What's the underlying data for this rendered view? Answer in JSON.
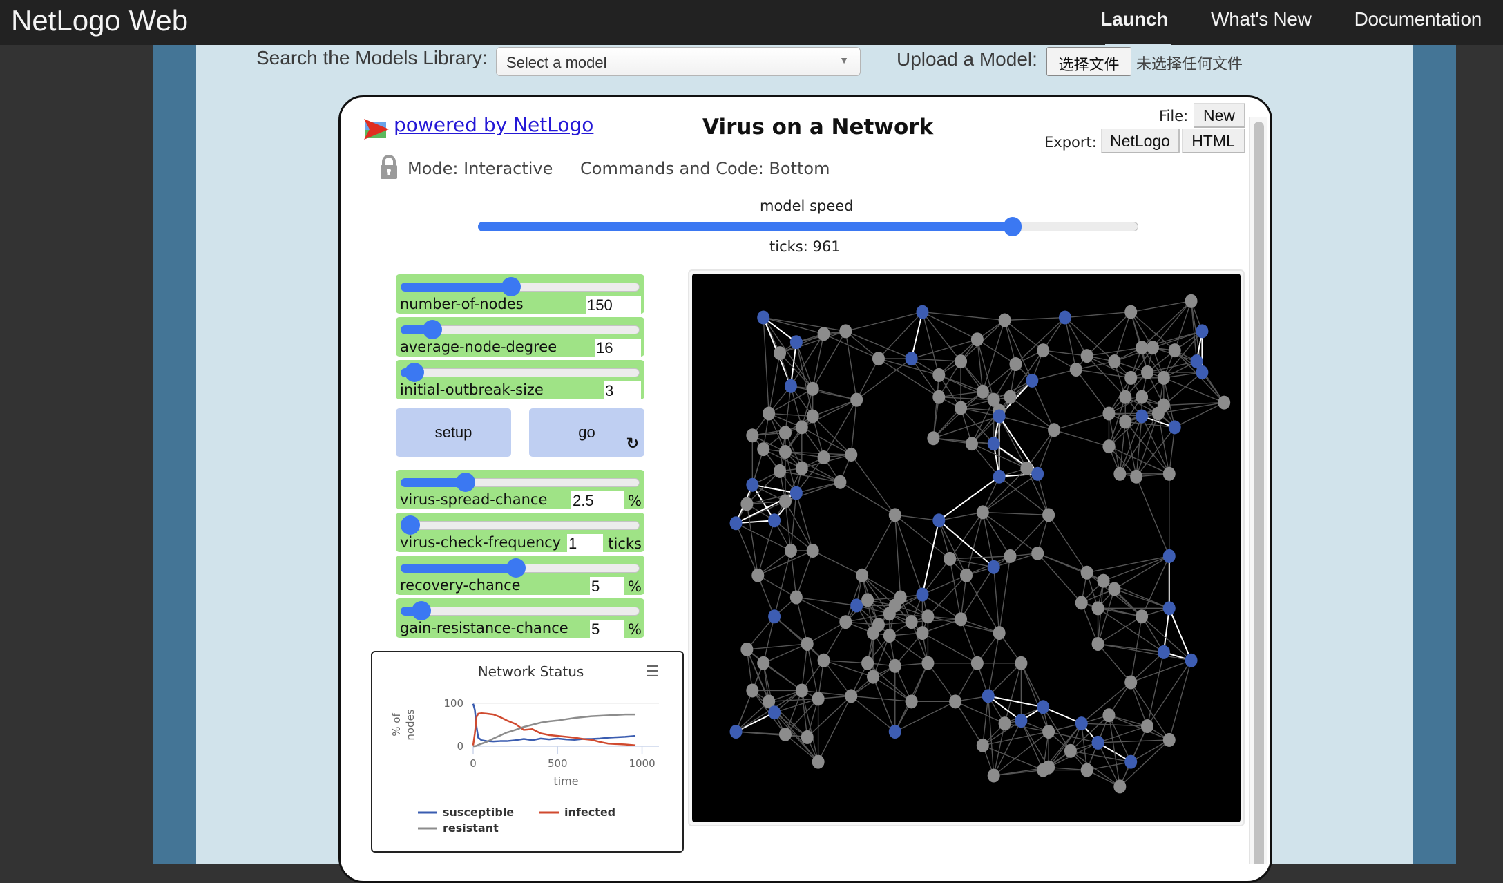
{
  "topbar": {
    "brand": "NetLogo Web",
    "nav": [
      {
        "label": "Launch",
        "active": true
      },
      {
        "label": "What's New",
        "active": false
      },
      {
        "label": "Documentation",
        "active": false
      }
    ]
  },
  "library": {
    "search_label": "Search the Models Library:",
    "select_value": "Select a model",
    "upload_label": "Upload a Model:",
    "upload_button": "选择文件",
    "upload_status": "未选择任何文件"
  },
  "model": {
    "powered_by": "powered by NetLogo",
    "title": "Virus on a Network",
    "mode": "Mode: Interactive",
    "commands_position": "Commands and Code: Bottom",
    "file_label": "File:",
    "file_new": "New",
    "export_label": "Export:",
    "export_netlogo": "NetLogo",
    "export_html": "HTML",
    "speed_label": "model speed",
    "speed_fraction": 0.81,
    "ticks_label": "ticks: 961"
  },
  "sliders": [
    {
      "name": "number-of-nodes",
      "value": "150",
      "unit": "",
      "fraction": 0.46
    },
    {
      "name": "average-node-degree",
      "value": "16",
      "unit": "",
      "fraction": 0.1
    },
    {
      "name": "initial-outbreak-size",
      "value": "3",
      "unit": "",
      "fraction": 0.02
    },
    {
      "name": "virus-spread-chance",
      "value": "2.5",
      "unit": "%",
      "fraction": 0.25
    },
    {
      "name": "virus-check-frequency",
      "value": "1",
      "unit": "ticks",
      "fraction": 0.0
    },
    {
      "name": "recovery-chance",
      "value": "5",
      "unit": "%",
      "fraction": 0.48
    },
    {
      "name": "gain-resistance-chance",
      "value": "5",
      "unit": "%",
      "fraction": 0.05
    }
  ],
  "buttons": {
    "setup": "setup",
    "go": "go"
  },
  "chart_data": {
    "type": "line",
    "title": "Network Status",
    "xlabel": "time",
    "ylabel": "% of nodes",
    "xlim": [
      0,
      1100
    ],
    "ylim": [
      0,
      100
    ],
    "xticks": [
      "0",
      "500",
      "1000"
    ],
    "yticks": [
      "0",
      "100"
    ],
    "legend": "bottom",
    "series": [
      {
        "name": "susceptible",
        "color": "#3a5cb0",
        "x": [
          0,
          10,
          20,
          30,
          50,
          80,
          120,
          160,
          200,
          250,
          300,
          350,
          400,
          450,
          500,
          550,
          600,
          650,
          700,
          750,
          800,
          850,
          900,
          961
        ],
        "y": [
          99,
          85,
          45,
          20,
          14,
          12,
          11,
          12,
          12,
          14,
          17,
          14,
          18,
          16,
          18,
          16,
          15,
          17,
          17,
          18,
          20,
          21,
          22,
          24
        ]
      },
      {
        "name": "infected",
        "color": "#d04a2f",
        "x": [
          0,
          10,
          20,
          30,
          50,
          80,
          120,
          160,
          200,
          250,
          300,
          350,
          400,
          450,
          500,
          550,
          600,
          650,
          700,
          750,
          800,
          850,
          900,
          961
        ],
        "y": [
          2,
          30,
          68,
          76,
          77,
          76,
          74,
          68,
          60,
          52,
          38,
          40,
          30,
          26,
          24,
          22,
          20,
          17,
          15,
          10,
          6,
          5,
          4,
          2
        ]
      },
      {
        "name": "resistant",
        "color": "#8c8c8c",
        "x": [
          0,
          10,
          20,
          30,
          50,
          80,
          120,
          160,
          200,
          250,
          300,
          350,
          400,
          450,
          500,
          550,
          600,
          650,
          700,
          750,
          800,
          850,
          900,
          961
        ],
        "y": [
          0,
          0,
          1,
          3,
          6,
          10,
          18,
          25,
          32,
          38,
          45,
          50,
          55,
          58,
          60,
          63,
          66,
          68,
          70,
          71,
          72,
          73,
          74,
          74
        ]
      }
    ]
  },
  "view": {
    "background": "#000000",
    "susceptible_color": "#3d5db3",
    "resistant_color": "#8c8c8c",
    "link_color": "#555555",
    "resistant_link_color": "#ffffff",
    "nodes": [
      [
        0.13,
        0.08,
        "s"
      ],
      [
        0.42,
        0.07,
        "s"
      ],
      [
        0.57,
        0.085,
        "g"
      ],
      [
        0.68,
        0.08,
        "s"
      ],
      [
        0.8,
        0.07,
        "g"
      ],
      [
        0.91,
        0.05,
        "g"
      ],
      [
        0.24,
        0.11,
        "g"
      ],
      [
        0.28,
        0.105,
        "g"
      ],
      [
        0.19,
        0.125,
        "s"
      ],
      [
        0.16,
        0.145,
        "g"
      ],
      [
        0.34,
        0.155,
        "g"
      ],
      [
        0.4,
        0.155,
        "s"
      ],
      [
        0.52,
        0.12,
        "g"
      ],
      [
        0.49,
        0.16,
        "g"
      ],
      [
        0.59,
        0.165,
        "g"
      ],
      [
        0.64,
        0.14,
        "g"
      ],
      [
        0.72,
        0.15,
        "g"
      ],
      [
        0.7,
        0.175,
        "g"
      ],
      [
        0.77,
        0.16,
        "g"
      ],
      [
        0.82,
        0.135,
        "g"
      ],
      [
        0.84,
        0.135,
        "g"
      ],
      [
        0.88,
        0.14,
        "g"
      ],
      [
        0.93,
        0.105,
        "s"
      ],
      [
        0.92,
        0.16,
        "s"
      ],
      [
        0.45,
        0.185,
        "g"
      ],
      [
        0.62,
        0.195,
        "s"
      ],
      [
        0.83,
        0.18,
        "g"
      ],
      [
        0.8,
        0.19,
        "g"
      ],
      [
        0.86,
        0.19,
        "g"
      ],
      [
        0.93,
        0.18,
        "s"
      ],
      [
        0.18,
        0.205,
        "s"
      ],
      [
        0.22,
        0.21,
        "g"
      ],
      [
        0.3,
        0.23,
        "g"
      ],
      [
        0.45,
        0.225,
        "g"
      ],
      [
        0.53,
        0.215,
        "g"
      ],
      [
        0.55,
        0.23,
        "g"
      ],
      [
        0.58,
        0.225,
        "g"
      ],
      [
        0.56,
        0.25,
        "g"
      ],
      [
        0.79,
        0.225,
        "g"
      ],
      [
        0.82,
        0.225,
        "g"
      ],
      [
        0.86,
        0.24,
        "g"
      ],
      [
        0.97,
        0.235,
        "g"
      ],
      [
        0.14,
        0.255,
        "g"
      ],
      [
        0.22,
        0.26,
        "g"
      ],
      [
        0.49,
        0.245,
        "g"
      ],
      [
        0.56,
        0.26,
        "s"
      ],
      [
        0.76,
        0.255,
        "g"
      ],
      [
        0.79,
        0.27,
        "g"
      ],
      [
        0.82,
        0.26,
        "s"
      ],
      [
        0.85,
        0.255,
        "g"
      ],
      [
        0.88,
        0.28,
        "s"
      ],
      [
        0.66,
        0.285,
        "g"
      ],
      [
        0.11,
        0.295,
        "g"
      ],
      [
        0.17,
        0.29,
        "g"
      ],
      [
        0.2,
        0.28,
        "g"
      ],
      [
        0.44,
        0.3,
        "g"
      ],
      [
        0.51,
        0.31,
        "g"
      ],
      [
        0.55,
        0.31,
        "s"
      ],
      [
        0.76,
        0.315,
        "g"
      ],
      [
        0.13,
        0.32,
        "g"
      ],
      [
        0.17,
        0.325,
        "g"
      ],
      [
        0.24,
        0.335,
        "g"
      ],
      [
        0.29,
        0.33,
        "g"
      ],
      [
        0.16,
        0.36,
        "g"
      ],
      [
        0.2,
        0.355,
        "g"
      ],
      [
        0.87,
        0.365,
        "g"
      ],
      [
        0.56,
        0.37,
        "s"
      ],
      [
        0.61,
        0.355,
        "g"
      ],
      [
        0.63,
        0.365,
        "s"
      ],
      [
        0.78,
        0.365,
        "g"
      ],
      [
        0.81,
        0.37,
        "g"
      ],
      [
        0.11,
        0.385,
        "s"
      ],
      [
        0.19,
        0.4,
        "s"
      ],
      [
        0.27,
        0.38,
        "g"
      ],
      [
        0.1,
        0.42,
        "g"
      ],
      [
        0.17,
        0.415,
        "g"
      ],
      [
        0.53,
        0.435,
        "g"
      ],
      [
        0.65,
        0.44,
        "g"
      ],
      [
        0.08,
        0.455,
        "s"
      ],
      [
        0.15,
        0.45,
        "s"
      ],
      [
        0.37,
        0.44,
        "g"
      ],
      [
        0.45,
        0.45,
        "s"
      ],
      [
        0.18,
        0.505,
        "g"
      ],
      [
        0.22,
        0.505,
        "g"
      ],
      [
        0.47,
        0.52,
        "g"
      ],
      [
        0.58,
        0.515,
        "g"
      ],
      [
        0.63,
        0.51,
        "g"
      ],
      [
        0.87,
        0.515,
        "s"
      ],
      [
        0.12,
        0.55,
        "g"
      ],
      [
        0.31,
        0.55,
        "g"
      ],
      [
        0.5,
        0.55,
        "g"
      ],
      [
        0.55,
        0.535,
        "s"
      ],
      [
        0.72,
        0.545,
        "g"
      ],
      [
        0.75,
        0.56,
        "g"
      ],
      [
        0.19,
        0.59,
        "g"
      ],
      [
        0.42,
        0.585,
        "s"
      ],
      [
        0.3,
        0.605,
        "s"
      ],
      [
        0.32,
        0.595,
        "g"
      ],
      [
        0.37,
        0.605,
        "g"
      ],
      [
        0.38,
        0.59,
        "g"
      ],
      [
        0.77,
        0.575,
        "g"
      ],
      [
        0.87,
        0.61,
        "s"
      ],
      [
        0.71,
        0.6,
        "g"
      ],
      [
        0.74,
        0.61,
        "g"
      ],
      [
        0.15,
        0.625,
        "s"
      ],
      [
        0.28,
        0.635,
        "g"
      ],
      [
        0.34,
        0.64,
        "g"
      ],
      [
        0.36,
        0.62,
        "g"
      ],
      [
        0.4,
        0.635,
        "g"
      ],
      [
        0.43,
        0.625,
        "g"
      ],
      [
        0.49,
        0.63,
        "g"
      ],
      [
        0.82,
        0.625,
        "g"
      ],
      [
        0.1,
        0.685,
        "g"
      ],
      [
        0.21,
        0.675,
        "g"
      ],
      [
        0.33,
        0.655,
        "g"
      ],
      [
        0.36,
        0.66,
        "g"
      ],
      [
        0.42,
        0.655,
        "g"
      ],
      [
        0.56,
        0.655,
        "g"
      ],
      [
        0.74,
        0.675,
        "g"
      ],
      [
        0.86,
        0.69,
        "s"
      ],
      [
        0.91,
        0.705,
        "s"
      ],
      [
        0.13,
        0.71,
        "g"
      ],
      [
        0.24,
        0.705,
        "g"
      ],
      [
        0.32,
        0.71,
        "g"
      ],
      [
        0.37,
        0.715,
        "g"
      ],
      [
        0.43,
        0.71,
        "g"
      ],
      [
        0.52,
        0.71,
        "g"
      ],
      [
        0.6,
        0.71,
        "g"
      ],
      [
        0.33,
        0.735,
        "g"
      ],
      [
        0.11,
        0.76,
        "g"
      ],
      [
        0.2,
        0.76,
        "g"
      ],
      [
        0.8,
        0.745,
        "g"
      ],
      [
        0.14,
        0.78,
        "g"
      ],
      [
        0.23,
        0.775,
        "g"
      ],
      [
        0.29,
        0.77,
        "g"
      ],
      [
        0.4,
        0.78,
        "g"
      ],
      [
        0.48,
        0.78,
        "g"
      ],
      [
        0.54,
        0.77,
        "s"
      ],
      [
        0.64,
        0.79,
        "s"
      ],
      [
        0.15,
        0.8,
        "s"
      ],
      [
        0.08,
        0.835,
        "s"
      ],
      [
        0.17,
        0.84,
        "g"
      ],
      [
        0.21,
        0.845,
        "g"
      ],
      [
        0.37,
        0.835,
        "s"
      ],
      [
        0.57,
        0.82,
        "g"
      ],
      [
        0.6,
        0.815,
        "s"
      ],
      [
        0.65,
        0.835,
        "g"
      ],
      [
        0.71,
        0.82,
        "s"
      ],
      [
        0.76,
        0.805,
        "g"
      ],
      [
        0.83,
        0.825,
        "g"
      ],
      [
        0.53,
        0.86,
        "g"
      ],
      [
        0.69,
        0.87,
        "g"
      ],
      [
        0.74,
        0.855,
        "s"
      ],
      [
        0.8,
        0.89,
        "s"
      ],
      [
        0.87,
        0.85,
        "g"
      ],
      [
        0.23,
        0.89,
        "g"
      ],
      [
        0.55,
        0.915,
        "g"
      ],
      [
        0.64,
        0.905,
        "g"
      ],
      [
        0.72,
        0.905,
        "g"
      ],
      [
        0.78,
        0.935,
        "g"
      ],
      [
        0.65,
        0.9,
        "g"
      ]
    ]
  }
}
